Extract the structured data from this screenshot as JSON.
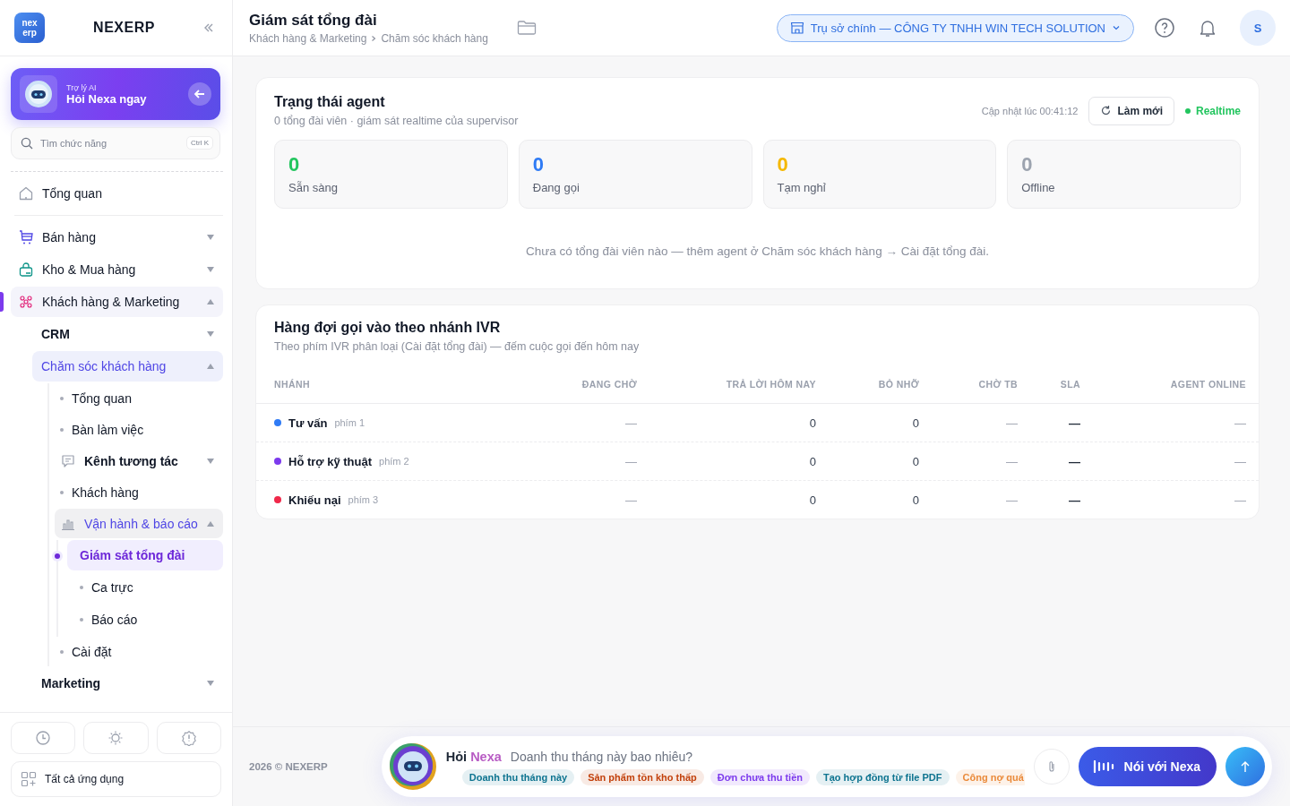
{
  "sidebar": {
    "brand": "NEXERP",
    "logo": "nex erp",
    "assistant": {
      "label": "Trợ lý AI",
      "title": "Hỏi Nexa ngay"
    },
    "search": {
      "placeholder": "Tìm chức năng",
      "shortcut": "Ctrl K"
    },
    "home": {
      "label": "Tổng quan"
    },
    "nav": [
      {
        "label": "Bán hàng",
        "expanded": false
      },
      {
        "label": "Kho & Mua hàng",
        "expanded": false
      },
      {
        "label": "Khách hàng & Marketing",
        "expanded": true,
        "children": [
          {
            "label": "CRM",
            "expanded": false
          },
          {
            "label": "Chăm sóc khách hàng",
            "expanded": true,
            "children": [
              {
                "label": "Tổng quan",
                "kind": "link",
                "selected": false
              },
              {
                "label": "Bàn làm việc",
                "kind": "link",
                "selected": false
              },
              {
                "label": "Kênh tương tác",
                "kind": "group",
                "expanded": false
              },
              {
                "label": "Khách hàng",
                "kind": "link",
                "selected": false
              },
              {
                "label": "Vận hành & báo cáo",
                "kind": "group",
                "expanded": true,
                "children": [
                  {
                    "label": "Giám sát tổng đài",
                    "selected": true
                  },
                  {
                    "label": "Ca trực",
                    "selected": false
                  },
                  {
                    "label": "Báo cáo",
                    "selected": false
                  }
                ]
              },
              {
                "label": "Cài đặt",
                "kind": "link",
                "selected": false
              }
            ]
          },
          {
            "label": "Marketing",
            "expanded": false
          }
        ]
      }
    ],
    "all_apps": "Tất cả ứng dụng"
  },
  "header": {
    "title": "Giám sát tổng đài",
    "breadcrumb": [
      "Khách hàng & Marketing",
      "Chăm sóc khách hàng"
    ],
    "branch": "Trụ sở chính — CÔNG TY TNHH WIN TECH SOLUTION",
    "avatar": "S"
  },
  "agent_status": {
    "title": "Trạng thái agent",
    "subtitle": "0 tổng đài viên · giám sát realtime của supervisor",
    "updated": "Cập nhật lúc 00:41:12",
    "refresh": "Làm mới",
    "live": "Realtime",
    "stats": [
      {
        "value": "0",
        "label": "Sẵn sàng",
        "color": "#22c55e"
      },
      {
        "value": "0",
        "label": "Đang gọi",
        "color": "#2f7bf5"
      },
      {
        "value": "0",
        "label": "Tạm nghỉ",
        "color": "#f5b800"
      },
      {
        "value": "0",
        "label": "Offline",
        "color": "#9ca3af"
      }
    ],
    "empty": "Chưa có tổng đài viên nào — thêm agent ở Chăm sóc khách hàng → Cài đặt tổng đài."
  },
  "queue": {
    "title": "Hàng đợi gọi vào theo nhánh IVR",
    "subtitle": "Theo phím IVR phân loại (Cài đặt tổng đài) — đếm cuộc gọi đến hôm nay",
    "columns": [
      "NHÁNH",
      "ĐANG CHỜ",
      "TRẢ LỜI HÔM NAY",
      "BỎ NHỠ",
      "CHỜ TB",
      "SLA",
      "AGENT ONLINE"
    ],
    "rows": [
      {
        "key": "phím 1",
        "color": "#2f7bf5",
        "cells": [
          "Tư vấn",
          "—",
          "0",
          "0",
          "—",
          "—",
          "—"
        ]
      },
      {
        "key": "phím 2",
        "color": "#7c3aed",
        "cells": [
          "Hỗ trợ kỹ thuật",
          "—",
          "0",
          "0",
          "—",
          "—",
          "—"
        ]
      },
      {
        "key": "phím 3",
        "color": "#f0284a",
        "cells": [
          "Khiếu nại",
          "—",
          "0",
          "0",
          "—",
          "—",
          "—"
        ]
      }
    ]
  },
  "footer": {
    "copyright": "2026 © NEXERP",
    "ask": {
      "prefix": "Hỏi",
      "name": "Nexa",
      "placeholder": "Doanh thu tháng này bao nhiêu?",
      "chips": [
        {
          "label": "Doanh thu tháng này",
          "color": "#0e7490"
        },
        {
          "label": "Sản phẩm tồn kho thấp",
          "color": "#c2410c"
        },
        {
          "label": "Đơn chưa thu tiền",
          "color": "#7c3aed"
        },
        {
          "label": "Tạo hợp đồng từ file PDF",
          "color": "#0e7490"
        },
        {
          "label": "Công nợ quá",
          "color": "#ea8a3a"
        }
      ],
      "voice": "Nói với Nexa"
    }
  }
}
